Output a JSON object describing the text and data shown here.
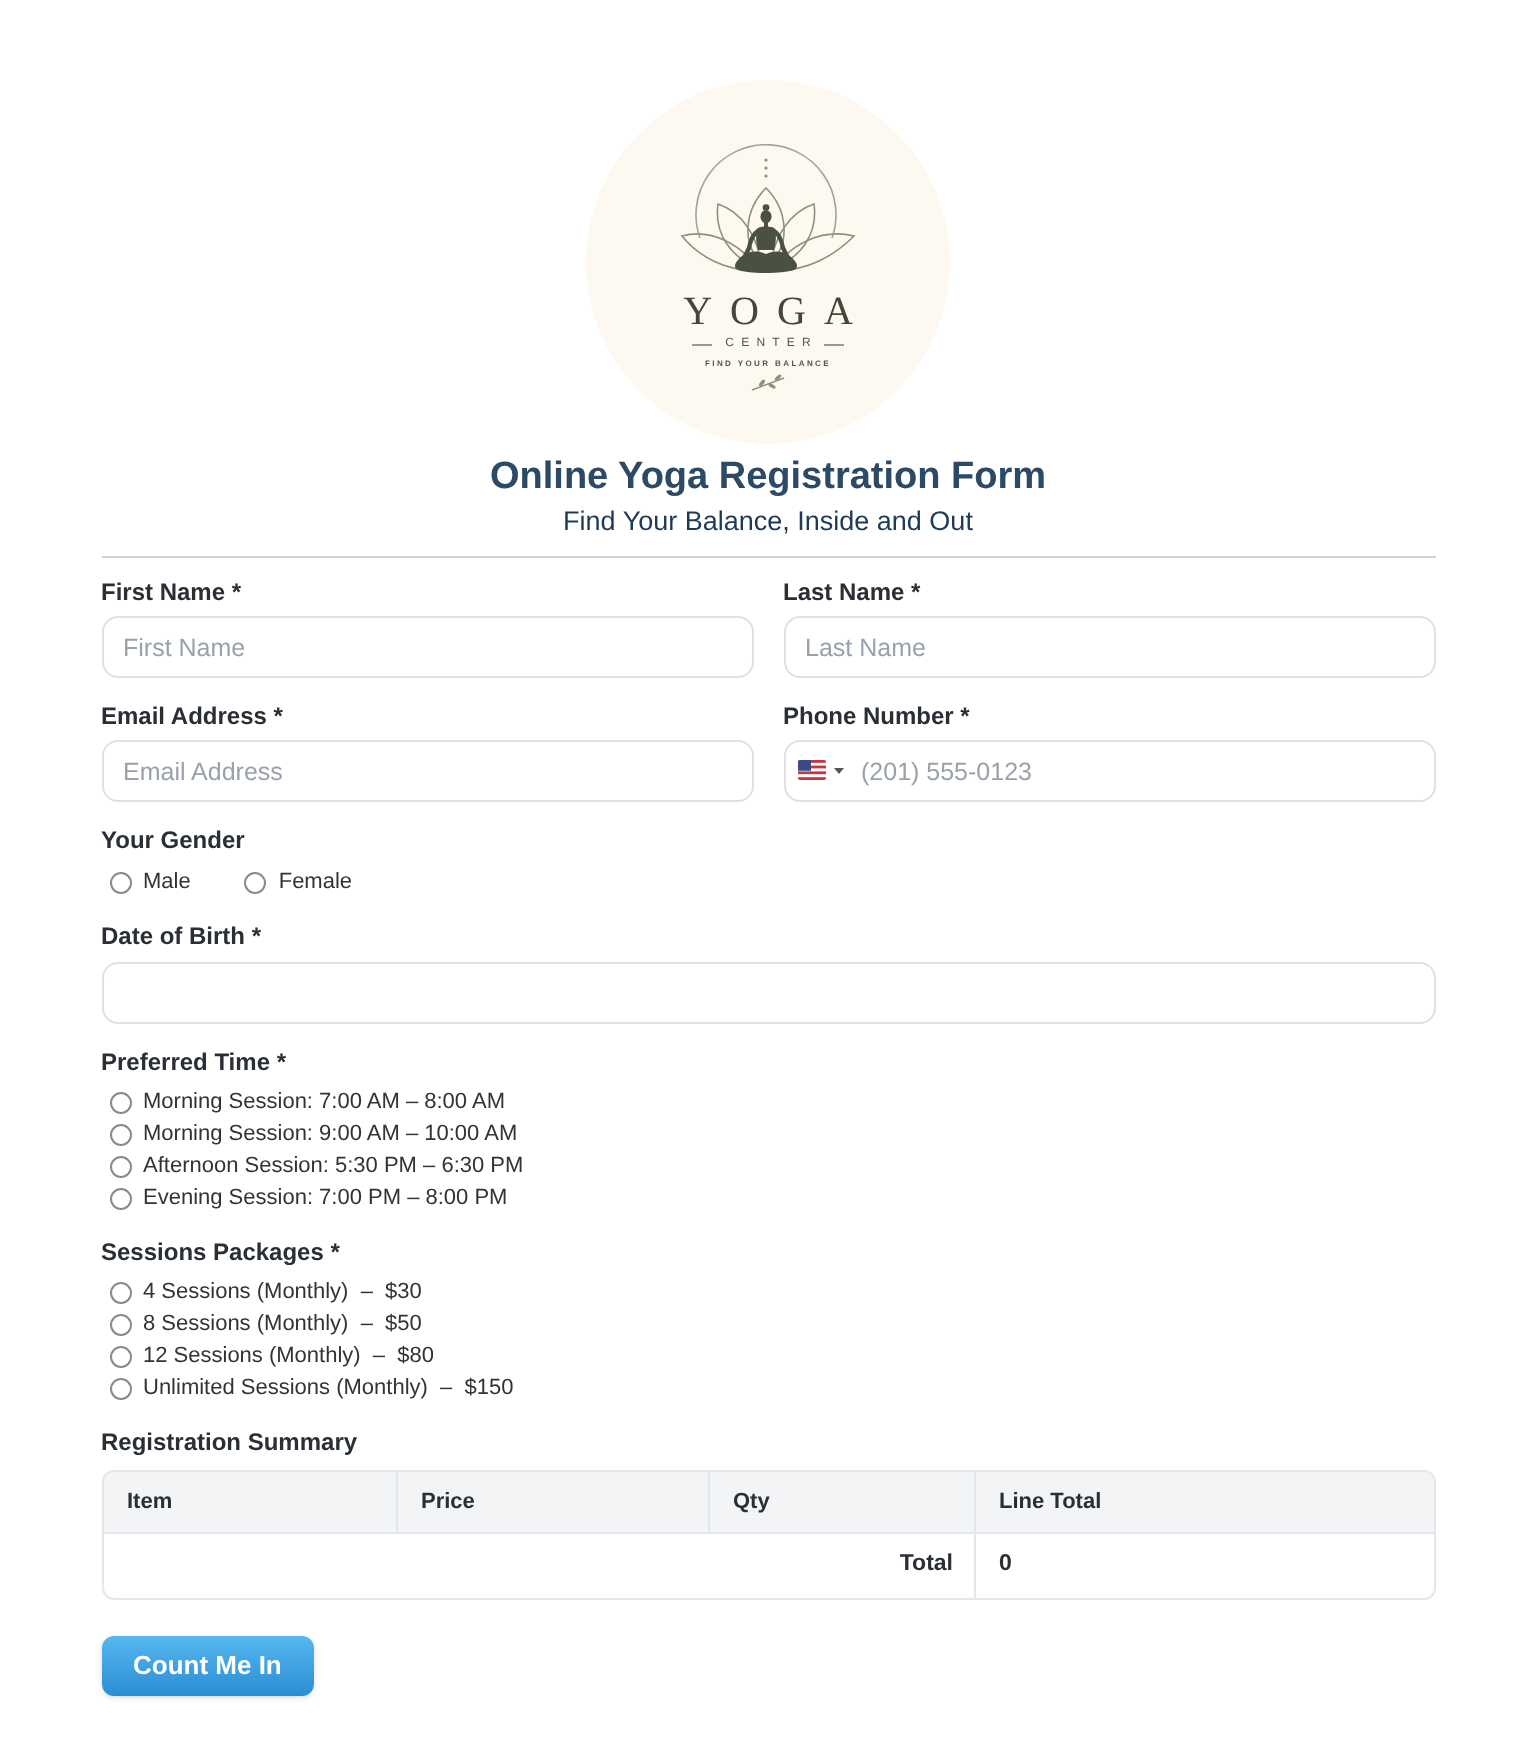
{
  "logo": {
    "title": "YOGA",
    "subtitle": "CENTER",
    "tagline": "FIND YOUR BALANCE"
  },
  "header": {
    "title": "Online Yoga Registration Form",
    "subtitle": "Find Your Balance, Inside and Out"
  },
  "sections": [
    {
      "kind": "pair",
      "fields": [
        {
          "kind": "text",
          "label": "First Name *",
          "placeholder": "First Name"
        },
        {
          "kind": "text",
          "label": "Last Name *",
          "placeholder": "Last Name"
        }
      ]
    },
    {
      "kind": "pair",
      "fields": [
        {
          "kind": "text",
          "label": "Email Address *",
          "placeholder": "Email Address"
        },
        {
          "kind": "phone",
          "label": "Phone Number *",
          "placeholder": "(201) 555-0123"
        }
      ]
    },
    {
      "kind": "radio_inline",
      "label": "Your Gender",
      "options": [
        {
          "label": "Male",
          "selected": false
        },
        {
          "label": "Female",
          "selected": false
        }
      ]
    },
    {
      "kind": "date",
      "label": "Date of Birth *"
    },
    {
      "kind": "radio_list",
      "label": "Preferred Time *",
      "options": [
        {
          "label": "Morning Session: 7:00 AM – 8:00 AM",
          "selected": false
        },
        {
          "label": "Morning Session: 9:00 AM – 10:00 AM",
          "selected": false
        },
        {
          "label": "Afternoon Session: 5:30 PM – 6:30 PM",
          "selected": false
        },
        {
          "label": "Evening Session: 7:00 PM – 8:00 PM",
          "selected": false
        }
      ]
    },
    {
      "kind": "radio_list",
      "label": "Sessions Packages *",
      "options": [
        {
          "label": "4 Sessions (Monthly)  –  $30",
          "selected": false
        },
        {
          "label": "8 Sessions (Monthly)  –  $50",
          "selected": false
        },
        {
          "label": "12 Sessions (Monthly)  –  $80",
          "selected": false
        },
        {
          "label": "Unlimited Sessions (Monthly)  –  $150",
          "selected": false
        }
      ]
    },
    {
      "kind": "summary",
      "label": "Registration Summary",
      "columns": [
        "Item",
        "Price",
        "Qty",
        "Line Total"
      ],
      "total_label": "Total",
      "total_value": "0"
    }
  ],
  "submit": {
    "label": "Count Me In"
  }
}
